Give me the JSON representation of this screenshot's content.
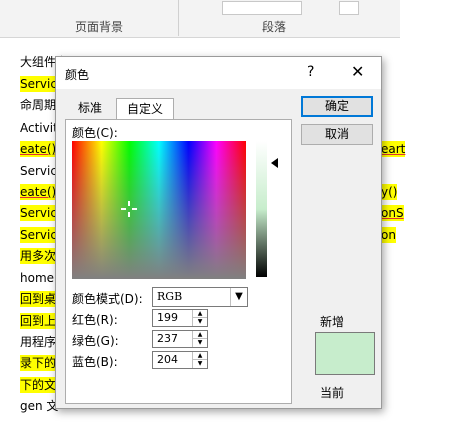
{
  "ribbon": {
    "group_page_background": "页面背景",
    "group_paragraph": "段落"
  },
  "document": {
    "lines": [
      {
        "text": "大组件之",
        "highlight": false
      },
      {
        "text": "Service",
        "highlight": true
      },
      {
        "text": "命周期",
        "highlight": false
      },
      {
        "text": "Activit",
        "highlight": false
      },
      {
        "text": "eate().",
        "highlight": true
      },
      {
        "text": "Service",
        "highlight": false
      },
      {
        "text": "eate()-",
        "highlight": true
      },
      {
        "text": "Servic",
        "highlight": true
      },
      {
        "text": "Servic",
        "highlight": true
      },
      {
        "text": "用多次",
        "highlight": true
      },
      {
        "text": "home",
        "highlight": false
      },
      {
        "text": "回到桌",
        "highlight": true
      },
      {
        "text": "回到上一",
        "highlight": true
      },
      {
        "text": "用程序",
        "highlight": false
      },
      {
        "text": "录下的",
        "highlight": true
      },
      {
        "text": "下的文",
        "highlight": true
      },
      {
        "text": "gen 文",
        "highlight": false
      }
    ],
    "right_fragments": [
      "eart",
      "y()",
      "onS",
      "on"
    ]
  },
  "dialog": {
    "title": "颜色",
    "help": "?",
    "close": "✕",
    "tabs": [
      "标准",
      "自定义"
    ],
    "ok_label": "确定",
    "cancel_label": "取消",
    "colors_label": "颜色(C):",
    "mode_label": "颜色模式(D):",
    "mode_value": "RGB",
    "red_label": "红色(R):",
    "green_label": "绿色(G):",
    "blue_label": "蓝色(B):",
    "red_value": "199",
    "green_value": "237",
    "blue_value": "204",
    "new_label": "新增",
    "current_label": "当前",
    "new_color": "#c7edcc"
  }
}
